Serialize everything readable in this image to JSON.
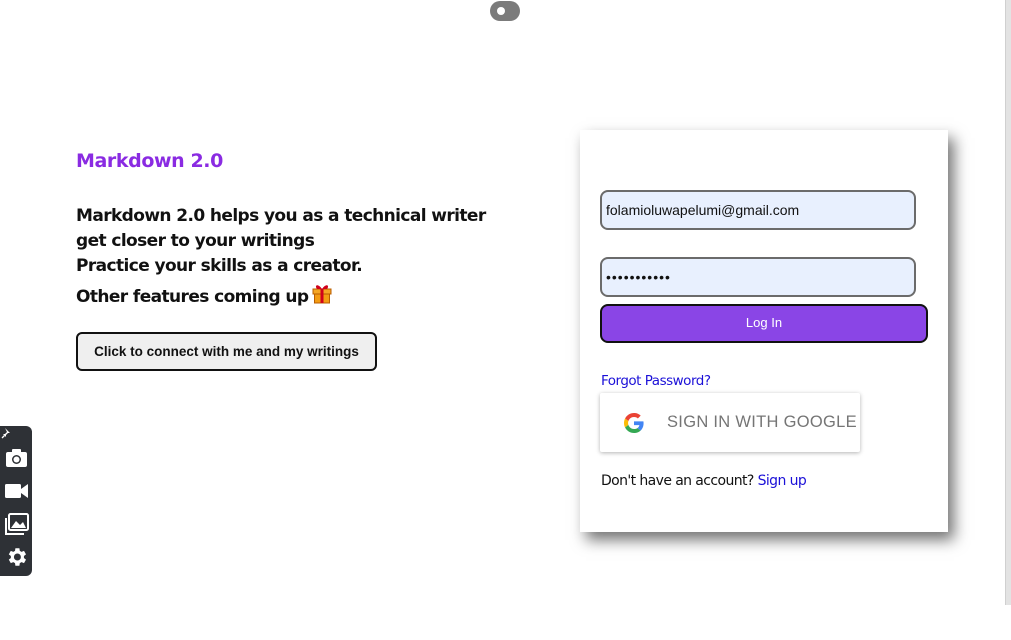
{
  "toggle": {
    "state": "off"
  },
  "hero": {
    "brand": "Markdown 2.0",
    "lines": [
      "Markdown 2.0 helps you as a technical writer",
      "get closer to your writings",
      "Practice your skills as a creator.",
      "Other features coming up"
    ],
    "gift_icon": "gift-icon",
    "connect_button": "Click to connect with me and my writings"
  },
  "login": {
    "email_value": "folamioluwapelumi@gmail.com",
    "password_value": "•••••••••••",
    "login_button": "Log In",
    "forgot_password": "Forgot Password?",
    "google_button": "SIGN IN WITH GOOGLE",
    "no_account_text": "Don't have an account?",
    "signup_link": "Sign up"
  },
  "toolbar": {
    "icons": [
      "pin-icon",
      "camera-icon",
      "video-icon",
      "gallery-icon",
      "settings-icon"
    ]
  },
  "colors": {
    "brand": "#8a2be2",
    "login_button_bg": "#8a45e6",
    "link": "#1b10d8",
    "input_bg": "#e8f0fe"
  }
}
